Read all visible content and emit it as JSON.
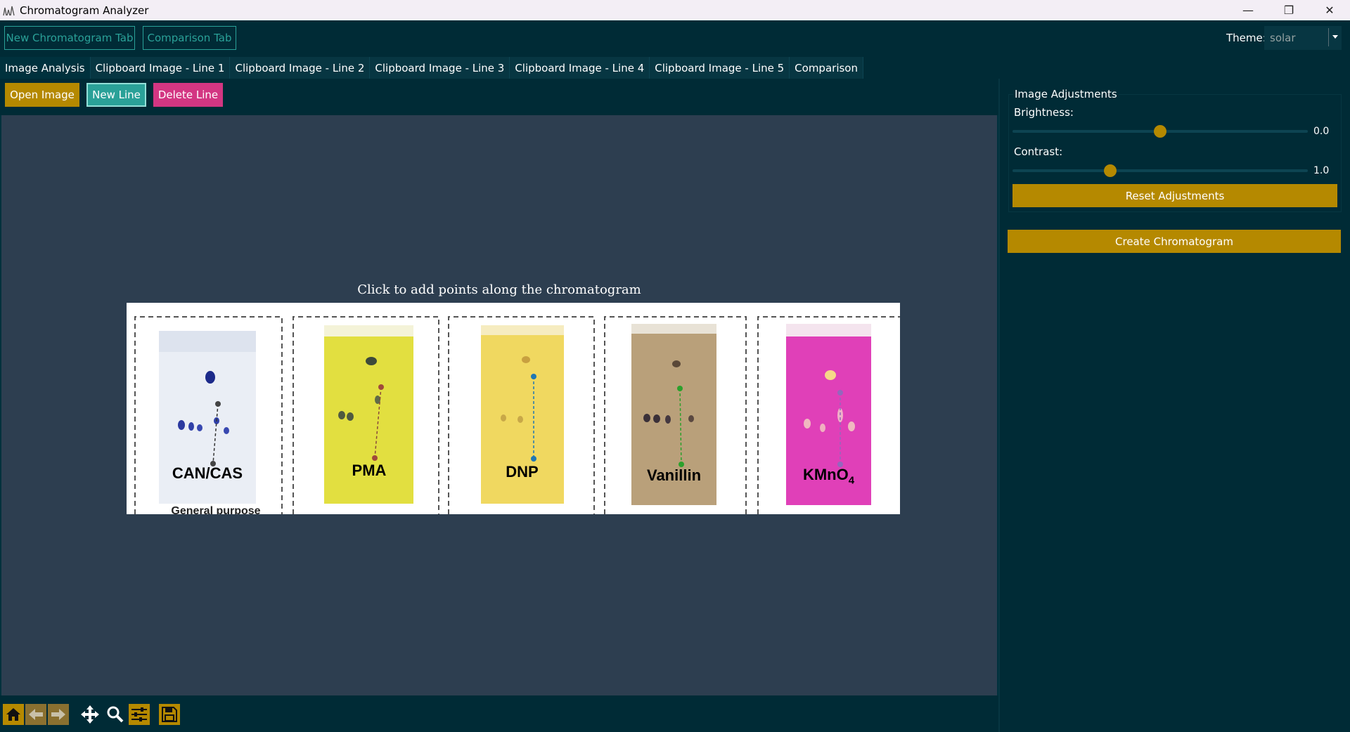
{
  "window": {
    "title": "Chromatogram Analyzer"
  },
  "top": {
    "new_chromatogram_tab": "New Chromatogram Tab",
    "comparison_tab": "Comparison Tab",
    "theme_label": "Theme:",
    "theme_value": "solar"
  },
  "tabs": [
    {
      "label": "Image Analysis"
    },
    {
      "label": "Clipboard Image - Line 1"
    },
    {
      "label": "Clipboard Image - Line 2"
    },
    {
      "label": "Clipboard Image - Line 3"
    },
    {
      "label": "Clipboard Image - Line 4"
    },
    {
      "label": "Clipboard Image - Line 5"
    },
    {
      "label": "Comparison"
    }
  ],
  "actions": {
    "open_image": "Open Image",
    "new_line": "New Line",
    "delete_line": "Delete Line"
  },
  "plot": {
    "title": "Click to add points along the chromatogram",
    "strips": [
      {
        "label": "CAN/CAS"
      },
      {
        "label": "PMA"
      },
      {
        "label": "DNP"
      },
      {
        "label": "Vanillin"
      },
      {
        "label": "KMnO",
        "subscript": "4"
      }
    ],
    "caption_fragment": "General purpose"
  },
  "adjustments": {
    "group_title": "Image Adjustments",
    "brightness_label": "Brightness:",
    "brightness_value": "0.0",
    "brightness_fraction": 0.5,
    "contrast_label": "Contrast:",
    "contrast_value": "1.0",
    "contrast_fraction": 0.33,
    "reset_label": "Reset Adjustments"
  },
  "create_chromatogram": "Create Chromatogram",
  "colors": {
    "accent_gold": "#b58900",
    "accent_teal": "#2aa198",
    "accent_magenta": "#d33682",
    "background": "#002b36"
  },
  "toolbar_icons": [
    "home-icon",
    "back-icon",
    "forward-icon",
    "pan-icon",
    "zoom-icon",
    "configure-icon",
    "save-icon"
  ]
}
